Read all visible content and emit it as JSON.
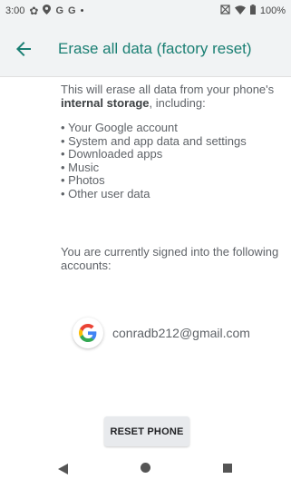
{
  "status_bar": {
    "time": "3:00",
    "notification_icons": [
      "gear-icon",
      "location-icon",
      "google-icon",
      "google-icon",
      "dot-icon"
    ],
    "battery": "100%"
  },
  "app_bar": {
    "title": "Erase all data (factory reset)"
  },
  "content": {
    "intro_prefix": "This will erase all data from your phone's ",
    "intro_bold": "internal storage",
    "intro_suffix": ", including:",
    "items": [
      "Your Google account",
      "System and app data and settings",
      "Downloaded apps",
      "Music",
      "Photos",
      "Other user data"
    ],
    "signed_in_text": "You are currently signed into the following accounts:"
  },
  "account": {
    "email": "conradb212@gmail.com"
  },
  "reset_button": {
    "label": "RESET PHONE"
  },
  "colors": {
    "accent": "#1a7f73",
    "bar_bg": "#f1f3f4"
  }
}
